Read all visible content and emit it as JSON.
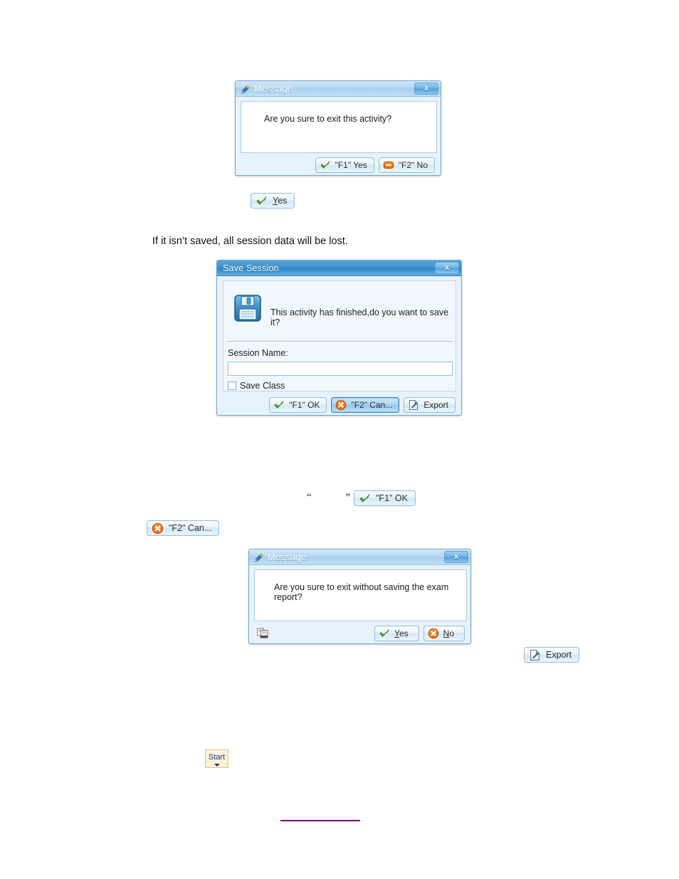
{
  "document": {
    "paragraph_1": "If it isn’t saved, all session data will be lost.",
    "quote_marks": "“   ”"
  },
  "dialog_exit_activity": {
    "title": "Message",
    "title_icon": "pencil-icon",
    "close_label": "x",
    "message": "Are you sure to exit this activity?",
    "buttons": [
      {
        "label": "\"F1\" Yes",
        "icon": "green-check-icon",
        "focused": false
      },
      {
        "label": "\"F2\" No",
        "icon": "orange-minus-icon",
        "focused": false
      }
    ]
  },
  "standalone_yes_button": {
    "label": "Yes",
    "accel": "Y",
    "icon": "green-check-icon"
  },
  "dialog_save_session": {
    "title": "Save Session",
    "close_label": "x",
    "icon": "floppy-disk-icon",
    "question": "This activity has finished,do you want to save it?",
    "session_name_label": "Session Name:",
    "session_name_value": "",
    "session_name_placeholder": "",
    "save_class_label": "Save Class",
    "save_class_checked": false,
    "buttons": [
      {
        "label": "\"F1\" OK",
        "icon": "green-check-icon",
        "focused": false
      },
      {
        "label": "\"F2\" Can...",
        "icon": "orange-x-icon",
        "focused": true
      },
      {
        "label": "Export",
        "icon": "export-page-icon",
        "focused": false
      }
    ]
  },
  "standalone_f1_ok_button": {
    "label": "\"F1\" OK",
    "icon": "green-check-icon"
  },
  "standalone_f2_cancel_button": {
    "label": "\"F2\" Can...",
    "icon": "orange-x-icon"
  },
  "dialog_exit_without_saving": {
    "title": "Message",
    "title_icon": "pencil-icon",
    "close_label": "x",
    "message": "Are you sure to exit without saving the exam report?",
    "copy_icon": "copy-icon",
    "buttons": [
      {
        "label": "Yes",
        "accel": "Y",
        "icon": "green-check-icon",
        "focused": false
      },
      {
        "label": "No",
        "accel": "N",
        "icon": "orange-x-icon",
        "focused": false
      }
    ]
  },
  "standalone_export_button": {
    "label": "Export",
    "icon": "export-page-icon"
  },
  "standalone_start_button": {
    "label": "Start",
    "caret": "dropdown-caret-icon"
  },
  "colors": {
    "dialog_bg": "#e8f2fb",
    "dialog_border": "#6fa8d0",
    "save_titlebar": "#3f92cd",
    "message_titlebar": "#bcdcf4",
    "accent_green": "#4caf27",
    "accent_orange": "#e8690c",
    "link_rule": "#7b0d6e",
    "start_bg": "#faf0d2",
    "start_text": "#20347a"
  }
}
